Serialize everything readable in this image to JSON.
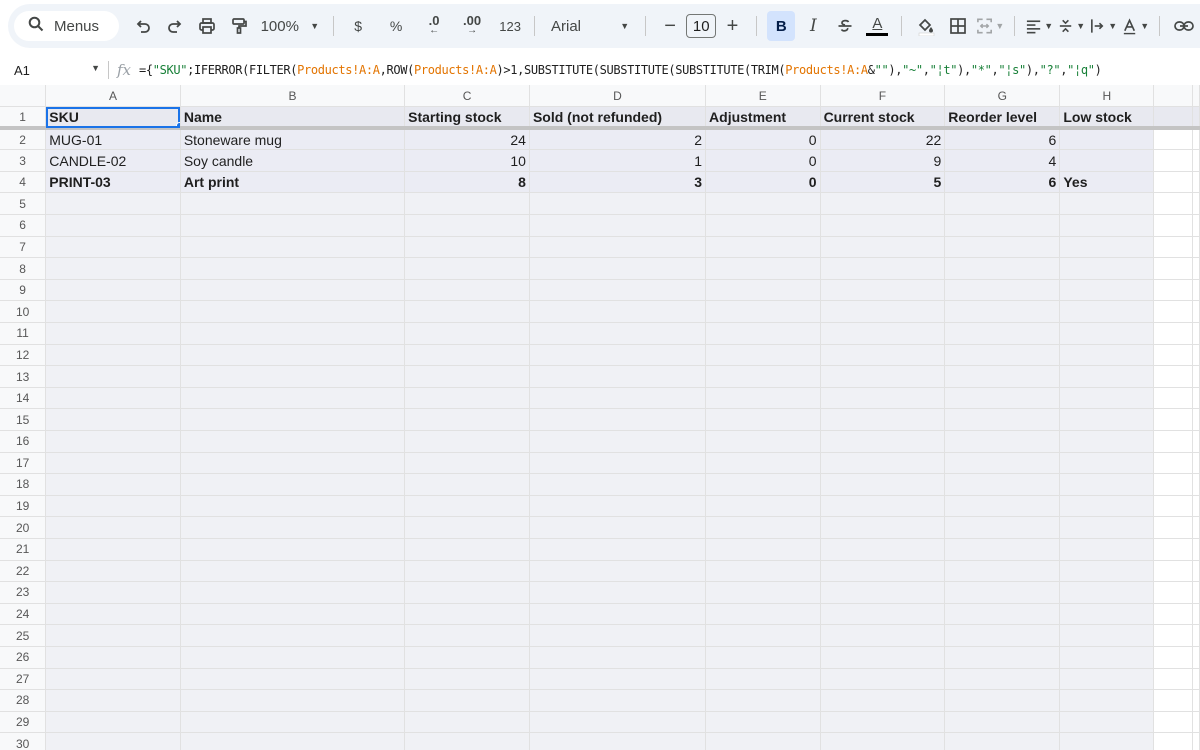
{
  "toolbar": {
    "menus_label": "Menus",
    "zoom": "100%",
    "currency": "$",
    "percent": "%",
    "decrease_decimal": ".0",
    "increase_decimal": ".00",
    "more_formats": "123",
    "font": "Arial",
    "font_size": "10",
    "minus": "−",
    "plus": "+",
    "bold": "B",
    "italic": "I",
    "text_color": "A"
  },
  "formula_bar": {
    "cell_ref": "A1",
    "fx": "fx",
    "parts": [
      {
        "t": "={",
        "k": "p"
      },
      {
        "t": "\"SKU\"",
        "k": "s"
      },
      {
        "t": ";IFERROR(FILTER(",
        "k": "p"
      },
      {
        "t": "Products!A:A",
        "k": "r"
      },
      {
        "t": ",ROW(",
        "k": "p"
      },
      {
        "t": "Products!A:A",
        "k": "r"
      },
      {
        "t": ")>1,SUBSTITUTE(SUBSTITUTE(SUBSTITUTE(TRIM(",
        "k": "p"
      },
      {
        "t": "Products!A:A",
        "k": "r"
      },
      {
        "t": "&",
        "k": "p"
      },
      {
        "t": "\"\"",
        "k": "s"
      },
      {
        "t": "),",
        "k": "p"
      },
      {
        "t": "\"~\"",
        "k": "s"
      },
      {
        "t": ",",
        "k": "p"
      },
      {
        "t": "\"¦t\"",
        "k": "s"
      },
      {
        "t": "),",
        "k": "p"
      },
      {
        "t": "\"*\"",
        "k": "s"
      },
      {
        "t": ",",
        "k": "p"
      },
      {
        "t": "\"¦s\"",
        "k": "s"
      },
      {
        "t": "),",
        "k": "p"
      },
      {
        "t": "\"?\"",
        "k": "s"
      },
      {
        "t": ",",
        "k": "p"
      },
      {
        "t": "\"¦q\"",
        "k": "s"
      },
      {
        "t": ")",
        "k": "p"
      }
    ]
  },
  "sheet": {
    "columns": [
      "A",
      "B",
      "C",
      "D",
      "E",
      "F",
      "G",
      "H"
    ],
    "header_row": [
      "SKU",
      "Name",
      "Starting stock",
      "Sold (not refunded)",
      "Adjustment",
      "Current stock",
      "Reorder level",
      "Low stock"
    ],
    "rows": [
      [
        "MUG-01",
        "Stoneware mug",
        "24",
        "2",
        "0",
        "22",
        "6",
        ""
      ],
      [
        "CANDLE-02",
        "Soy candle",
        "10",
        "1",
        "0",
        "9",
        "4",
        ""
      ],
      [
        "PRINT-03",
        "Art print",
        "8",
        "3",
        "0",
        "5",
        "6",
        "Yes"
      ]
    ],
    "bold_rows": [
      2
    ],
    "numeric_columns": [
      2,
      3,
      4,
      5,
      6
    ],
    "row_numbers": [
      "1",
      "2",
      "3",
      "4",
      "5",
      "6",
      "7",
      "8",
      "9",
      "10",
      "11",
      "12",
      "13",
      "14",
      "15",
      "16",
      "17",
      "18",
      "19",
      "20",
      "21",
      "22",
      "23",
      "24",
      "25",
      "26",
      "27",
      "28",
      "29",
      "30"
    ]
  },
  "colors": {
    "accent": "#1a73e8",
    "formula_string": "#188038",
    "formula_range": "#e37400",
    "toolbar_bg": "#f0f4f9"
  }
}
